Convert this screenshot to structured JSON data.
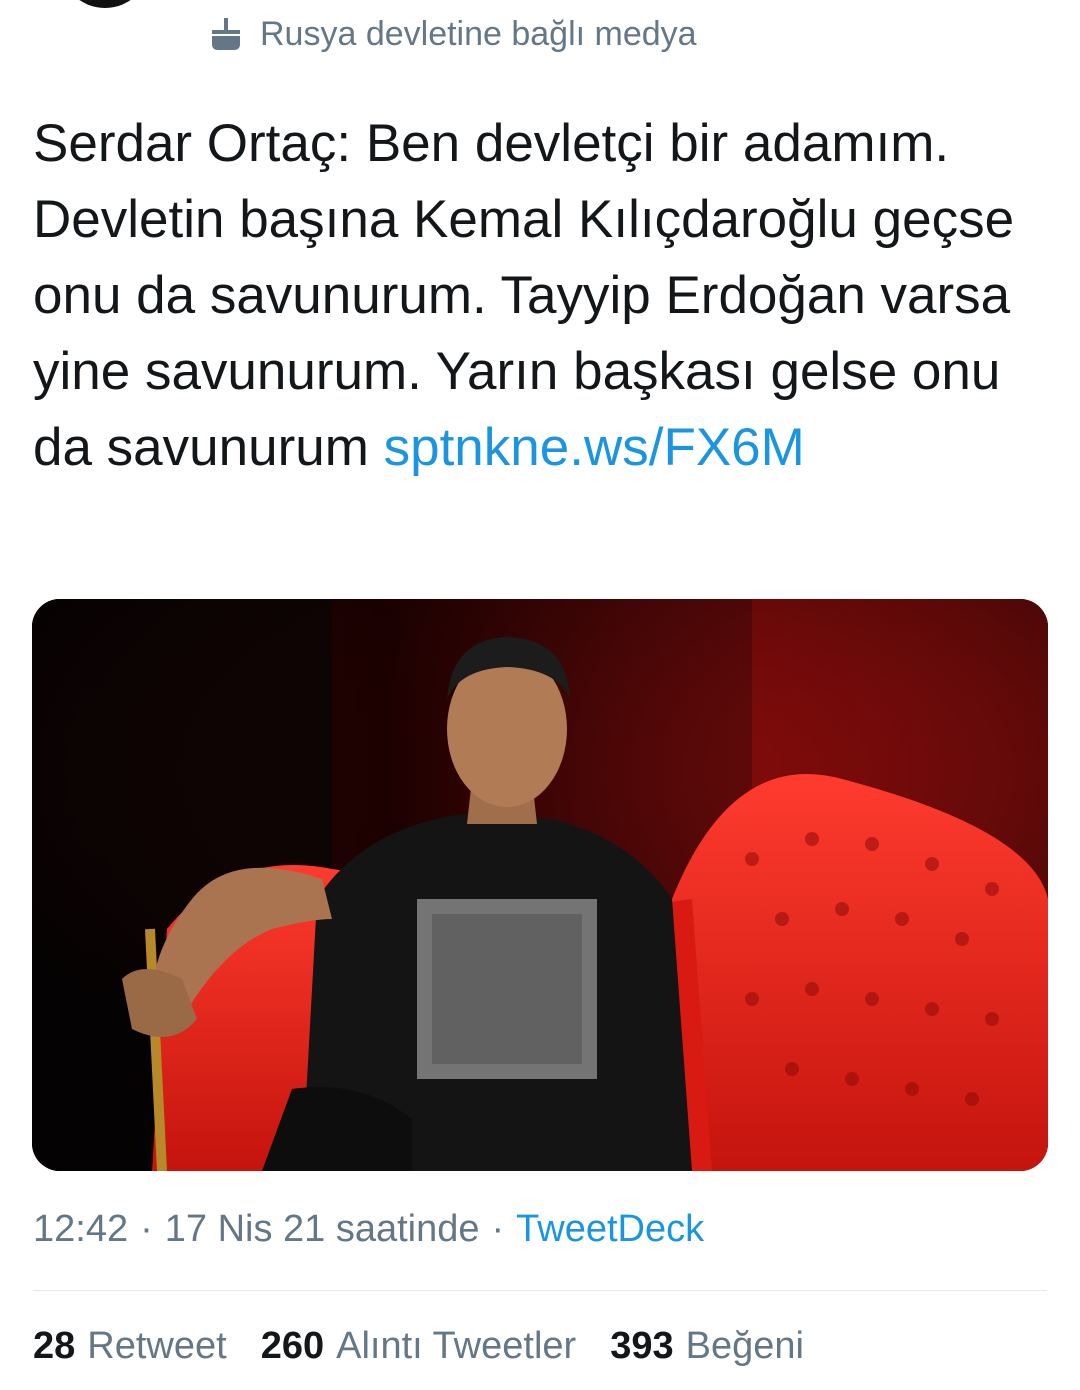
{
  "tweet": {
    "label": {
      "icon": "state-media-icon",
      "text": "Rusya devletine bağlı medya"
    },
    "text": "Serdar Ortaç: Ben devletçi bir adamım. Devletin başına Kemal Kılıçdaroğlu geçse onu da savunurum. Tayyip Erdoğan varsa yine savunurum. Yarın başkası gelse onu da savunurum",
    "link": "sptnkne.ws/FX6M",
    "meta": {
      "time": "12:42",
      "date": "17 Nis 21 saatinde",
      "separator": "·",
      "source": "TweetDeck"
    },
    "stats": {
      "retweets": {
        "count": "28",
        "label": "Retweet"
      },
      "quotes": {
        "count": "260",
        "label": "Alıntı Tweetler"
      },
      "likes": {
        "count": "393",
        "label": "Beğeni"
      }
    }
  },
  "colors": {
    "link": "#1b95e0",
    "secondary_text": "#657786",
    "primary_text": "#14171a",
    "divider": "#e1e8ed"
  }
}
